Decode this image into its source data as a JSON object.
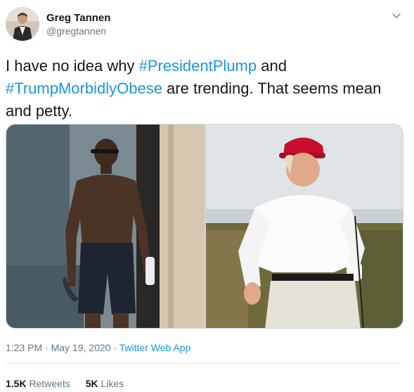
{
  "author": {
    "display_name": "Greg Tannen",
    "handle": "@gregtannen"
  },
  "tweet": {
    "text_part1": "I have no idea why ",
    "hashtag1": "#PresidentPlump",
    "text_part2": " and ",
    "hashtag2": "#TrumpMorbidlyObese",
    "text_part3": " are trending. That seems mean and petty."
  },
  "meta": {
    "time": "1:23 PM",
    "separator1": " · ",
    "date": "May 19, 2020",
    "separator2": " · ",
    "source_app": "Twitter Web App"
  },
  "stats": {
    "retweets_count": "1.5K",
    "retweets_label": "Retweets",
    "likes_count": "5K",
    "likes_label": "Likes"
  },
  "icons": {
    "menu": "chevron-down-icon"
  },
  "colors": {
    "link": "#1b95e0",
    "secondary_text": "#657786",
    "primary_text": "#14171a"
  }
}
